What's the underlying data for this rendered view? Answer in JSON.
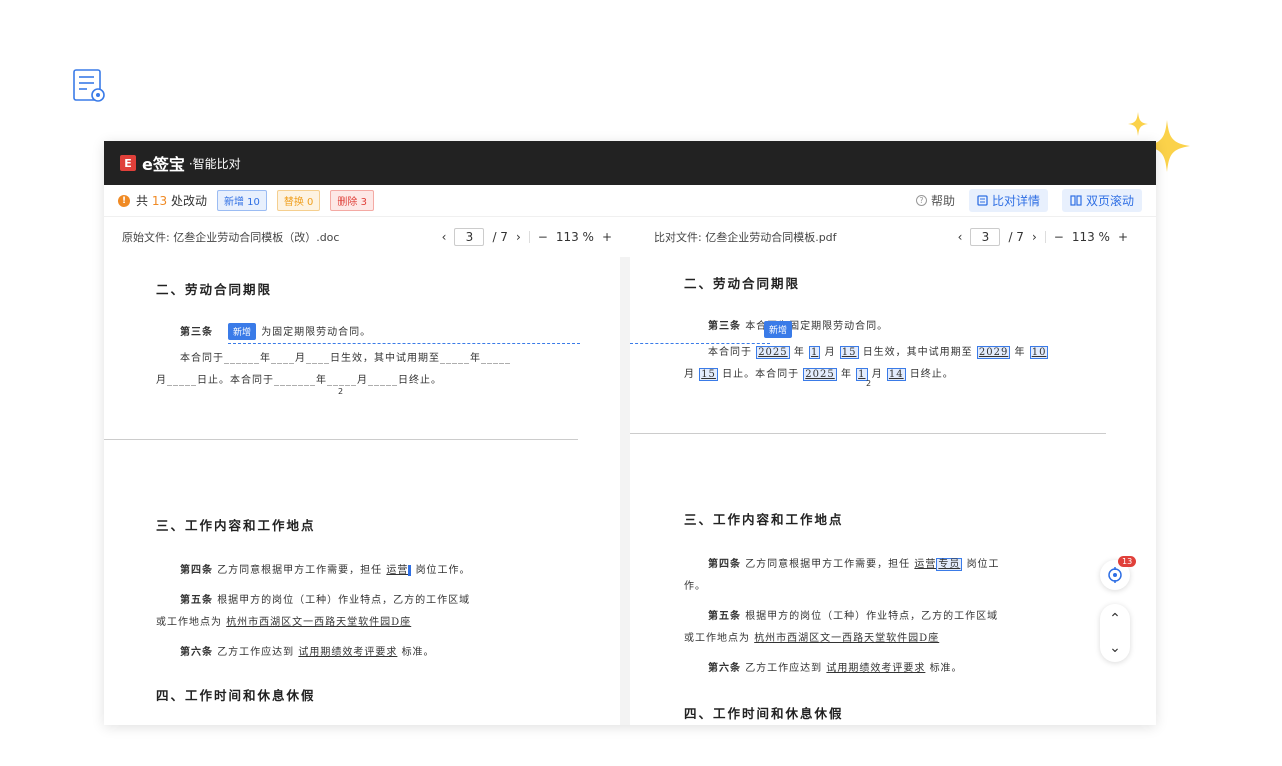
{
  "app": {
    "logo_mark": "E",
    "logo_text": "e签宝",
    "logo_sub": "·智能比对"
  },
  "toolbar": {
    "summary_prefix": "共",
    "summary_count": "13",
    "summary_suffix": "处改动",
    "badge_add": "新增 10",
    "badge_replace": "替换 0",
    "badge_delete": "删除 3",
    "help": "帮助",
    "detail_button": "比对详情",
    "scroll_button": "双页滚动"
  },
  "left_file": {
    "label": "原始文件: 亿叁企业劳动合同模板（改）.doc",
    "page": "3",
    "total": "/ 7",
    "zoom": "113 %"
  },
  "right_file": {
    "label": "比对文件: 亿叁企业劳动合同模板.pdf",
    "page": "3",
    "total": "/ 7",
    "zoom": "113 %"
  },
  "left_doc": {
    "h2": "二、劳动合同期限",
    "art3_label": "第三条",
    "art3_text": "为固定期限劳动合同。",
    "new_tag": "新增",
    "art3_line2": "本合同于______年____月____日生效，其中试用期至_____年_____",
    "art3_line3": "月_____日止。本合同于_______年_____月_____日终止。",
    "page_no": "2",
    "h3": "三、工作内容和工作地点",
    "art4_label": "第四条",
    "art4_text": "乙方同意根据甲方工作需要，担任",
    "art4_job": "运营",
    "art4_end": "岗位工作。",
    "art5_label": "第五条",
    "art5_text": "根据甲方的岗位（工种）作业特点，乙方的工作区域",
    "art5_line2": "或工作地点为",
    "art5_place": "杭州市西湖区文一西路天堂软件园D座",
    "art6_label": "第六条",
    "art6_text": "乙方工作应达到",
    "art6_std": "试用期绩效考评要求",
    "art6_end": "标准。",
    "h4": "四、工作时间和休息休假"
  },
  "right_doc": {
    "h2": "二、劳动合同期限",
    "art3_label": "第三条",
    "art3_text": "本合同为固定期限劳动合同。",
    "new_tag": "新增",
    "art3_line2a": "本合同于",
    "art3_y1": "2025",
    "art3_l2b": "年",
    "art3_m1": "1",
    "art3_l2c": "月",
    "art3_d1": "15",
    "art3_l2d": "日生效，其中试用期至",
    "art3_y2": "2029",
    "art3_l2e": "年",
    "art3_m2": "10",
    "art3_line3a": "月",
    "art3_d2": "15",
    "art3_l3b": "日止。本合同于",
    "art3_y3": "2025",
    "art3_l3c": "年",
    "art3_m3": "1",
    "art3_l3d": "月",
    "art3_d3": "14",
    "art3_l3e": "日终止。",
    "page_no": "2",
    "h3": "三、工作内容和工作地点",
    "art4_label": "第四条",
    "art4_text": "乙方同意根据甲方工作需要，担任",
    "art4_job": "运营",
    "art4_job_new": "专员",
    "art4_end": "岗位工",
    "art4_wrap": "作。",
    "art5_label": "第五条",
    "art5_text": "根据甲方的岗位（工种）作业特点，乙方的工作区域",
    "art5_line2": "或工作地点为",
    "art5_place": "杭州市西湖区文一西路天堂软件园D座",
    "art6_label": "第六条",
    "art6_text": "乙方工作应达到",
    "art6_std": "试用期绩效考评要求",
    "art6_end": "标准。",
    "h4": "四、工作时间和休息休假"
  },
  "float": {
    "badge": "13",
    "up": "⌃",
    "down": "⌄"
  },
  "colors": {
    "accent": "#2f6fe4",
    "titlebar": "#222222",
    "brand": "#e0403a",
    "warn": "#f08a24"
  }
}
